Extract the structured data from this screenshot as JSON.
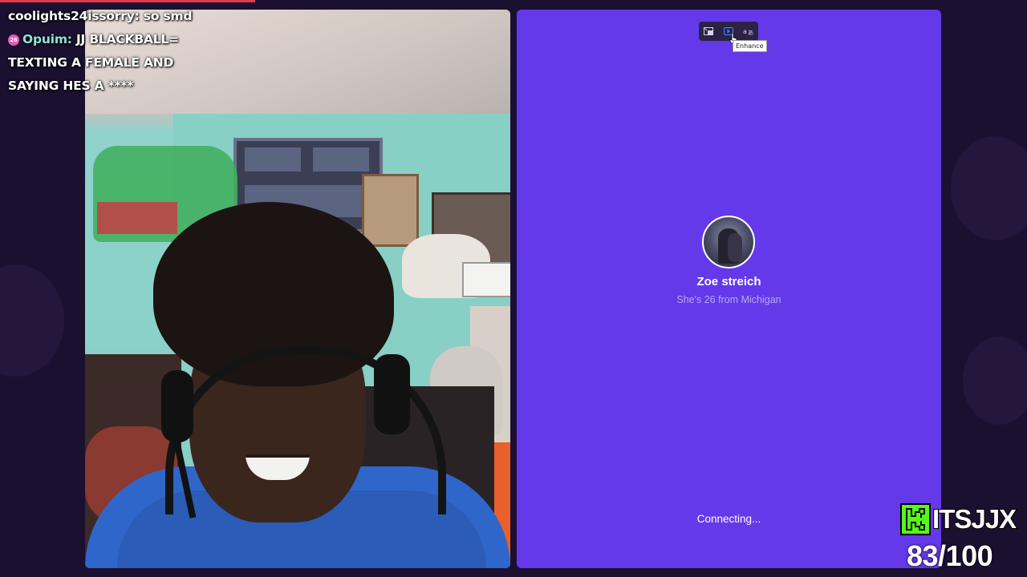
{
  "chat": {
    "messages": [
      {
        "user": "coolights24issorry:",
        "text": "so smd"
      },
      {
        "badge": "26",
        "user": "Opuim:",
        "text": "JJ BLACKBALL=",
        "continuation": [
          "TEXTING A FEMALE AND",
          "SAYING HES A ****"
        ]
      }
    ]
  },
  "call": {
    "toolbar": {
      "icons": [
        "pip-icon",
        "enhance-icon",
        "translate-icon"
      ],
      "tooltip": "Enhance"
    },
    "profile": {
      "name": "Zoe streich",
      "info": "She's 26 from Michigan"
    },
    "status": "Connecting..."
  },
  "overlay": {
    "brand": "ITSJJX",
    "counter": "83/100",
    "progress": 0.25
  },
  "colors": {
    "panel": "#6439ea",
    "background": "#1b1030",
    "brand_green": "#53fc18"
  }
}
